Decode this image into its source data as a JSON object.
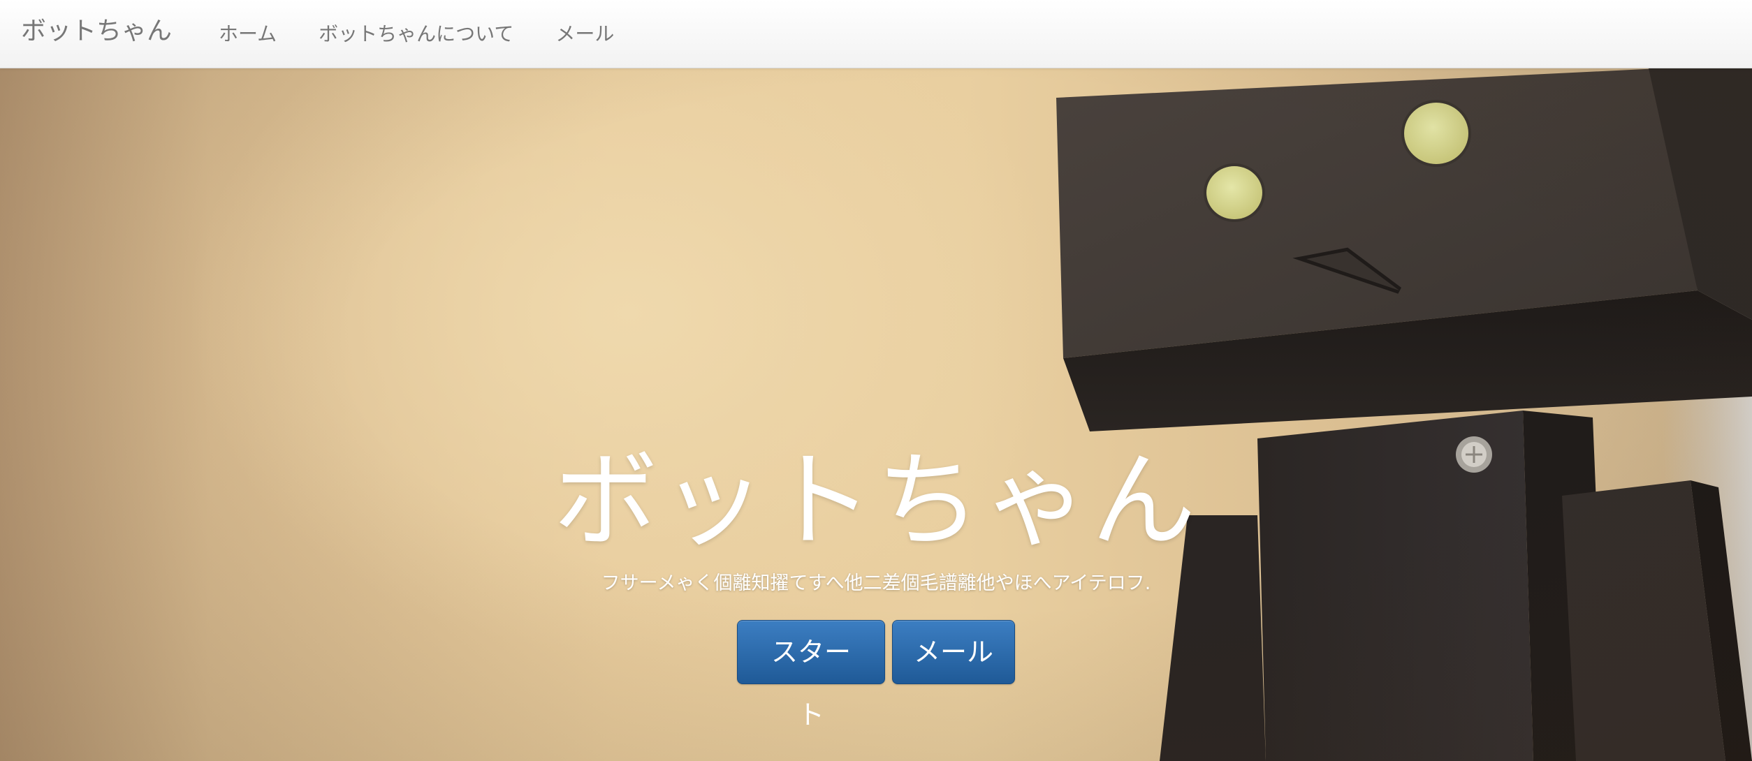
{
  "navbar": {
    "brand": "ボットちゃん",
    "items": [
      {
        "label": "ホーム"
      },
      {
        "label": "ボットちゃんについて"
      },
      {
        "label": "メール"
      }
    ]
  },
  "hero": {
    "title": "ボットちゃん",
    "subtitle": "フサーメゃく個離知擢てすへ他二差個毛譜離他やほへアイテロフ.",
    "buttons": {
      "start_label": "スタート",
      "mail_label": "メール"
    }
  },
  "colors": {
    "button_primary": "#2a6aab",
    "navbar_text": "#777777",
    "hero_text": "#ffffff"
  }
}
